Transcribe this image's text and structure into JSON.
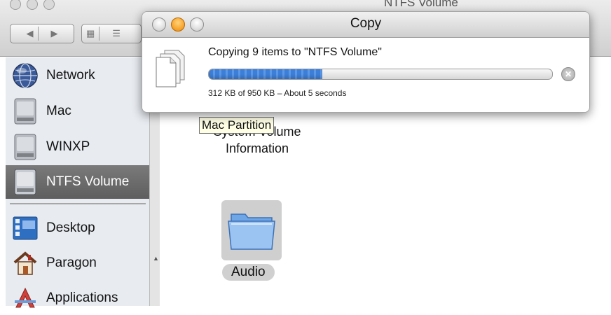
{
  "finder": {
    "title": "NTFS Volume",
    "sidebar": {
      "devices": [
        {
          "label": "Network",
          "icon": "network-globe-icon"
        },
        {
          "label": "Mac",
          "icon": "hard-drive-icon"
        },
        {
          "label": "WINXP",
          "icon": "hard-drive-icon"
        },
        {
          "label": "NTFS Volume",
          "icon": "hard-drive-icon",
          "selected": true
        }
      ],
      "places": [
        {
          "label": "Desktop",
          "icon": "desktop-icon"
        },
        {
          "label": "Paragon",
          "icon": "home-icon"
        },
        {
          "label": "Applications",
          "icon": "applications-icon"
        }
      ]
    },
    "content": {
      "items": [
        {
          "label": "System Volume\nInformation",
          "icon": "folder-icon"
        },
        {
          "label": "Audio",
          "icon": "folder-icon",
          "selected": true
        }
      ],
      "tooltip": "Mac Partition"
    }
  },
  "copy_dialog": {
    "title": "Copy",
    "message": "Copying 9 items to \"NTFS Volume\"",
    "status": "312 KB of 950 KB – About 5 seconds",
    "progress_fraction": 0.33
  },
  "colors": {
    "progress": "#3d7fd8",
    "selection": "#646464",
    "close_orange": "#f28a00"
  }
}
